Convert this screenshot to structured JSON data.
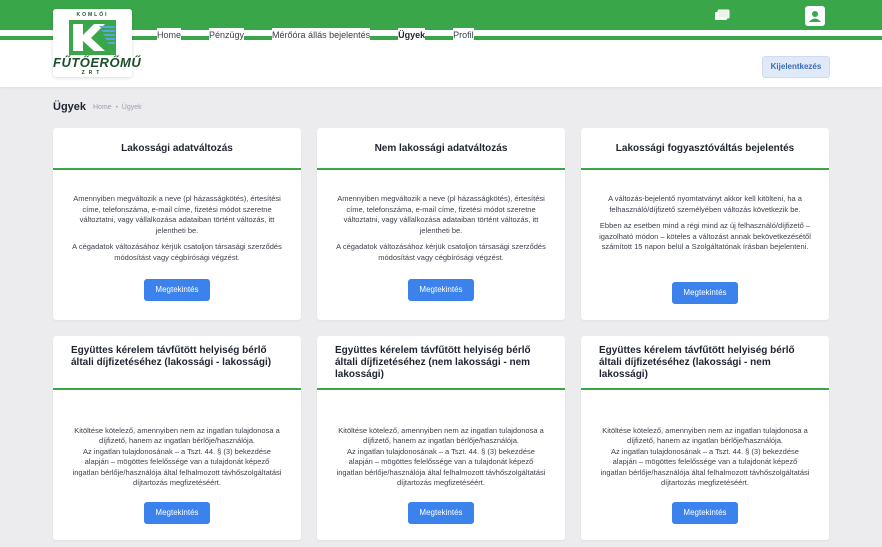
{
  "brand": {
    "logo_top": "KOMLÓI",
    "logo_name": "FŰTŐERŐMŰ",
    "logo_bottom": "ZRT"
  },
  "nav": {
    "items": [
      "Home",
      "Pénzügy",
      "Mérőóra állás bejelentés",
      "Ügyek",
      "Profil"
    ],
    "active": "Ügyek"
  },
  "header": {
    "logout_label": "Kijelentkezés",
    "icons": [
      "cart-icon",
      "user-icon"
    ]
  },
  "page": {
    "title": "Ügyek",
    "breadcrumb": [
      "Home",
      "Ügyek"
    ]
  },
  "colors": {
    "green": "#3aa64a",
    "button_blue": "#3b82ec",
    "background": "#ececef"
  },
  "cards": [
    {
      "title": "Lakossági adatváltozás",
      "paragraphs": [
        "Amennyiben megváltozik a neve (pl házasságkötés), értesítési címe, telefonszáma, e-mail címe, fizetési módot szeretne változtatni, vagy vállalkozása adataiban történt változás, itt jelentheti be.",
        "A cégadatok változásához kérjük csatoljon társasági szerződés módosítást vagy cégbírósági végzést."
      ],
      "button": "Megtekintés"
    },
    {
      "title": "Nem lakossági adatváltozás",
      "paragraphs": [
        "Amennyiben megváltozik a neve (pl házasságkötés), értesítési címe, telefonszáma, e-mail címe, fizetési módot szeretne változtatni, vagy vállalkozása adataiban történt változás, itt jelentheti be.",
        "A cégadatok változásához kérjük csatoljon társasági szerződés módosítást vagy cégbírósági végzést."
      ],
      "button": "Megtekintés"
    },
    {
      "title": "Lakossági fogyasztóváltás bejelentés",
      "paragraphs": [
        "A változás-bejelentő nyomtatványt akkor kell kitölteni, ha a felhasználó/díjfizető személyében változás következik be.",
        "Ebben az esetben mind a régi mind az új felhasználó/díjfizető – igazolható módon – köteles a változást annak bekövetkezésétől számított 15 napon belül a Szolgáltatónak írásban bejelenteni."
      ],
      "button": "Megtekintés"
    },
    {
      "title": "Együttes kérelem távfűtött helyiség bérlő általi díjfizetéséhez (lakossági - lakossági)",
      "paragraphs": [
        "Kitöltése kötelező, amennyiben nem az ingatlan tulajdonosa a díjfizető, hanem az ingatlan bérlője/használója.\nAz ingatlan tulajdonosának – a Tszt. 44. § (3) bekezdése alapján – mögöttes felelőssége van a tulajdonát képező ingatlan bérlője/használója által felhalmozott távhőszolgáltatási díjtartozás megfizetéséért."
      ],
      "button": "Megtekintés"
    },
    {
      "title": "Együttes kérelem távfűtött helyiség bérlő általi díjfizetéséhez (nem lakossági - nem lakossági)",
      "paragraphs": [
        "Kitöltése kötelező, amennyiben nem az ingatlan tulajdonosa a díjfizető, hanem az ingatlan bérlője/használója.\nAz ingatlan tulajdonosának – a Tszt. 44. § (3) bekezdése alapján – mögöttes felelőssége van a tulajdonát képező ingatlan bérlője/használója által felhalmozott távhőszolgáltatási díjtartozás megfizetéséért."
      ],
      "button": "Megtekintés"
    },
    {
      "title": "Együttes kérelem távfűtött helyiség bérlő általi díjfizetéséhez (lakossági - nem lakossági)",
      "paragraphs": [
        "Kitöltése kötelező, amennyiben nem az ingatlan tulajdonosa a díjfizető, hanem az ingatlan bérlője/használója.\nAz ingatlan tulajdonosának – a Tszt. 44. § (3) bekezdése alapján – mögöttes felelőssége van a tulajdonát képező ingatlan bérlője/használója által felhalmozott távhőszolgáltatási díjtartozás megfizetéséért."
      ],
      "button": "Megtekintés"
    }
  ]
}
